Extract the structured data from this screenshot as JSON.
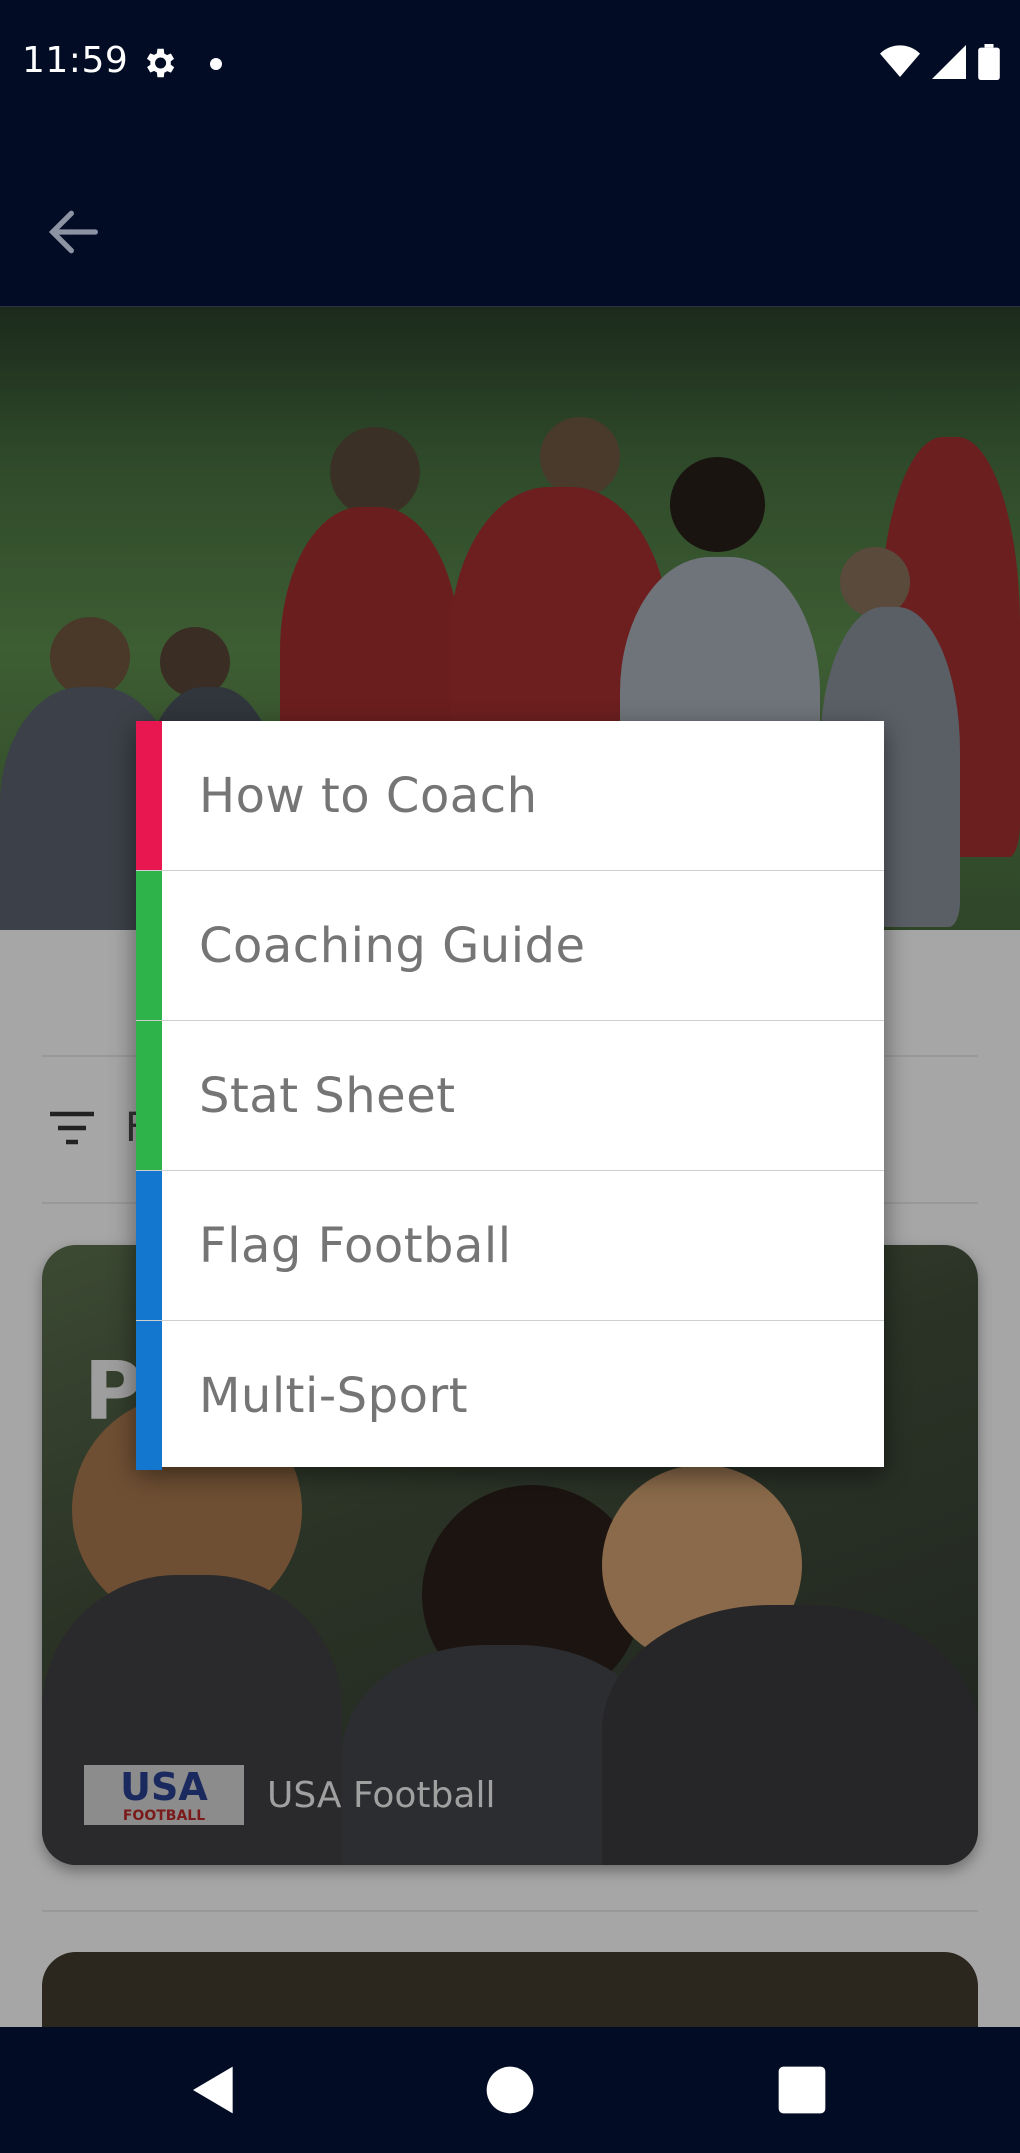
{
  "status_bar": {
    "time": "11:59",
    "icons": [
      "settings-gear-icon",
      "notification-dot-icon",
      "wifi-icon",
      "cell-signal-icon",
      "battery-icon"
    ]
  },
  "app_bar": {
    "back_icon": "arrow-back-icon"
  },
  "filter": {
    "icon": "filter-list-icon",
    "label": "F"
  },
  "card": {
    "title_partial": "P",
    "logo_text": "USA",
    "logo_subtext": "FOOTBALL",
    "source": "USA Football"
  },
  "menu": {
    "items": [
      {
        "label": "How to Coach",
        "accent": "#e8174f"
      },
      {
        "label": "Coaching Guide",
        "accent": "#2db34a"
      },
      {
        "label": "Stat Sheet",
        "accent": "#2db34a"
      },
      {
        "label": "Flag Football",
        "accent": "#1477cf"
      },
      {
        "label": "Multi-Sport",
        "accent": "#1477cf"
      }
    ]
  },
  "nav_bar": {
    "buttons": [
      "back-triangle-icon",
      "home-circle-icon",
      "recents-square-icon"
    ]
  },
  "colors": {
    "system_bar": "#020c24",
    "scrim_content": "#a6a6a6",
    "menu_bg": "#ffffff",
    "menu_text": "#757575"
  }
}
